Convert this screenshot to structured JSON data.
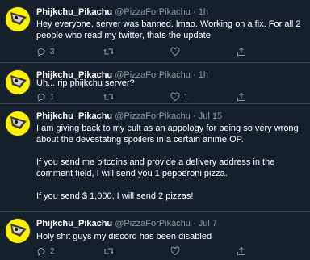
{
  "tweets": [
    {
      "author": "Phijkchu_Pikachu",
      "handle": "@PizzaForPikachu",
      "sep": "·",
      "time": "1h",
      "text": [
        "Hey everyone, server was banned. lmao. Working on a fix. For all 2 people who read my twitter, thats the update"
      ],
      "stats": {
        "reply": "3",
        "retweet": "",
        "like": ""
      }
    },
    {
      "author": "Phijkchu_Pikachu",
      "handle": "@PizzaForPikachu",
      "sep": "·",
      "time": "1h",
      "text": [
        "Uh... rip phijkchu server?"
      ],
      "stats": {
        "reply": "1",
        "retweet": "",
        "like": "1"
      }
    },
    {
      "author": "Phijkchu_Pikachu",
      "handle": "@PizzaForPikachu",
      "sep": "·",
      "time": "Jul 15",
      "text": [
        "I am giving back to my cult as an appology for being so very wrong about the devestating spoilers in a certain anime OP.",
        "If you send me bitcoins and provide a delivery address in the comment field, I will send you 1 pepperoni pizza.",
        "If you send $ 1,000, I will send 2 pizzas!"
      ],
      "stats": {
        "reply": "",
        "retweet": "",
        "like": ""
      }
    },
    {
      "author": "Phijkchu_Pikachu",
      "handle": "@PizzaForPikachu",
      "sep": "·",
      "time": "Jul 7",
      "text": [
        "Holy shit guys my discord has been disabled"
      ],
      "stats": {
        "reply": "2",
        "retweet": "",
        "like": ""
      }
    }
  ],
  "icons": {
    "reply": "reply-icon",
    "retweet": "retweet-icon",
    "like": "heart-icon",
    "share": "share-icon",
    "avatar": "pikachu-avatar"
  },
  "colors": {
    "background": "#15202b",
    "text": "#ffffff",
    "muted": "#8899a6",
    "divider": "#38444d",
    "avatar_bg": "#fff200"
  }
}
